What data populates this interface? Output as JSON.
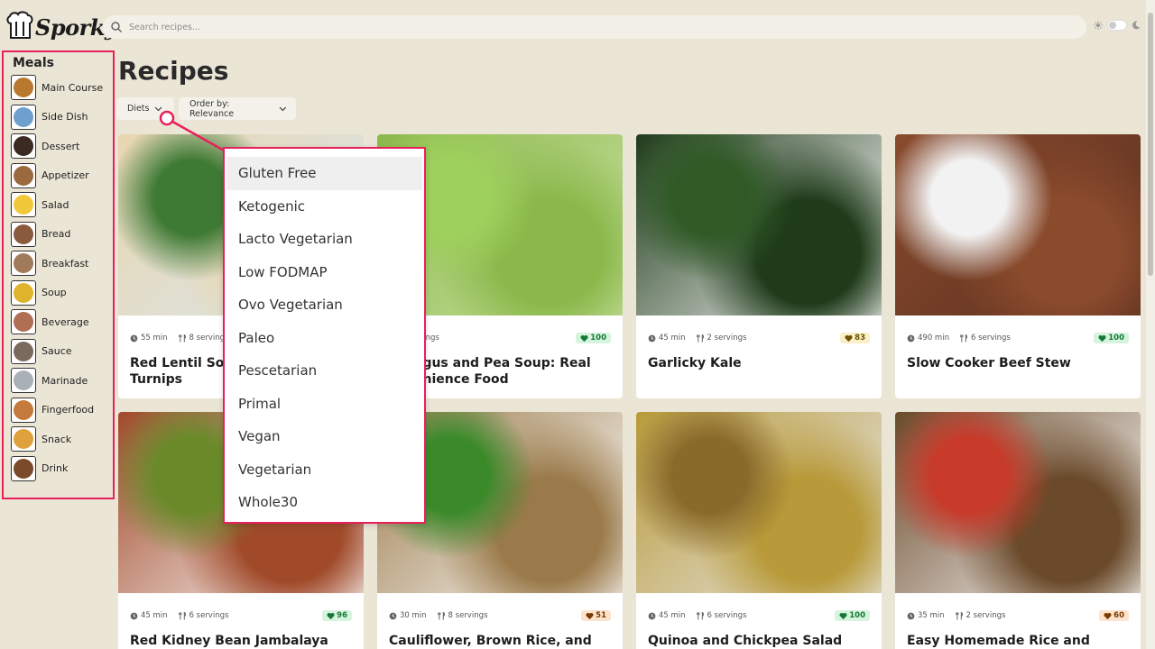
{
  "app": {
    "logo_text": "Sporky"
  },
  "search": {
    "placeholder": "Search recipes..."
  },
  "sidebar": {
    "title": "Meals",
    "items": [
      {
        "label": "Main Course",
        "icon": "main-course-icon",
        "color": "#b8792f"
      },
      {
        "label": "Side Dish",
        "icon": "side-dish-icon",
        "color": "#6f9fcf"
      },
      {
        "label": "Dessert",
        "icon": "dessert-icon",
        "color": "#3a2a22"
      },
      {
        "label": "Appetizer",
        "icon": "appetizer-icon",
        "color": "#9a6a3e"
      },
      {
        "label": "Salad",
        "icon": "salad-icon",
        "color": "#f0c83a"
      },
      {
        "label": "Bread",
        "icon": "bread-icon",
        "color": "#8a5a3c"
      },
      {
        "label": "Breakfast",
        "icon": "breakfast-icon",
        "color": "#a07a5a"
      },
      {
        "label": "Soup",
        "icon": "soup-icon",
        "color": "#e0b32c"
      },
      {
        "label": "Beverage",
        "icon": "beverage-icon",
        "color": "#b06e52"
      },
      {
        "label": "Sauce",
        "icon": "sauce-icon",
        "color": "#7a6a5e"
      },
      {
        "label": "Marinade",
        "icon": "marinade-icon",
        "color": "#a9b0b8"
      },
      {
        "label": "Fingerfood",
        "icon": "fingerfood-icon",
        "color": "#c47a3a"
      },
      {
        "label": "Snack",
        "icon": "snack-icon",
        "color": "#e0a03c"
      },
      {
        "label": "Drink",
        "icon": "drink-icon",
        "color": "#7a4a2a"
      }
    ]
  },
  "page": {
    "title": "Recipes"
  },
  "filters": {
    "diets_label": "Diets",
    "order_label": "Order by: Relevance"
  },
  "diets_dropdown": {
    "items": [
      "Gluten Free",
      "Ketogenic",
      "Lacto Vegetarian",
      "Low FODMAP",
      "Ovo Vegetarian",
      "Paleo",
      "Pescetarian",
      "Primal",
      "Vegan",
      "Vegetarian",
      "Whole30"
    ],
    "highlighted": "Gluten Free"
  },
  "recipes": [
    {
      "time": "55 min",
      "servings": "8 servings",
      "score": "",
      "title": "Red Lentil Soup with Chicken and Turnips",
      "visible_title": "Red Lentil Soup",
      "visible_title2": "Turnips",
      "colors": [
        "#e9d6b0",
        "#3f7a34",
        "#d8e6ee"
      ]
    },
    {
      "time": "",
      "servings": "2 servings",
      "score": "100",
      "score_tone": "green",
      "title1": "agus and Pea Soup: Real",
      "title2": "enience Food",
      "colors": [
        "#8ab84a",
        "#9ed05c",
        "#c9e0a0"
      ]
    },
    {
      "time": "45 min",
      "servings": "2 servings",
      "score": "83",
      "score_tone": "yellow",
      "title": "Garlicky Kale",
      "colors": [
        "#1f3b1a",
        "#2f5a26",
        "#ffffff"
      ]
    },
    {
      "time": "490 min",
      "servings": "6 servings",
      "score": "100",
      "score_tone": "green",
      "title": "Slow Cooker Beef Stew",
      "colors": [
        "#8a4a2c",
        "#f2f2f2",
        "#5a3020"
      ]
    },
    {
      "time": "45 min",
      "servings": "6 servings",
      "score": "96",
      "score_tone": "green",
      "title": "Red Kidney Bean Jambalaya",
      "colors": [
        "#a04a2a",
        "#6a8a2a",
        "#ffffff"
      ]
    },
    {
      "time": "30 min",
      "servings": "8 servings",
      "score": "51",
      "score_tone": "orange",
      "title": "Cauliflower, Brown Rice, and",
      "colors": [
        "#9a7a4a",
        "#3a8a2a",
        "#ffffff"
      ]
    },
    {
      "time": "45 min",
      "servings": "6 servings",
      "score": "100",
      "score_tone": "green",
      "title": "Quinoa and Chickpea Salad with",
      "colors": [
        "#b89a3a",
        "#8a6a2a",
        "#e8e8e8"
      ]
    },
    {
      "time": "35 min",
      "servings": "2 servings",
      "score": "60",
      "score_tone": "orange",
      "title": "Easy Homemade Rice and Beans",
      "colors": [
        "#6a4a2a",
        "#c83a2a",
        "#ffffff"
      ]
    }
  ]
}
